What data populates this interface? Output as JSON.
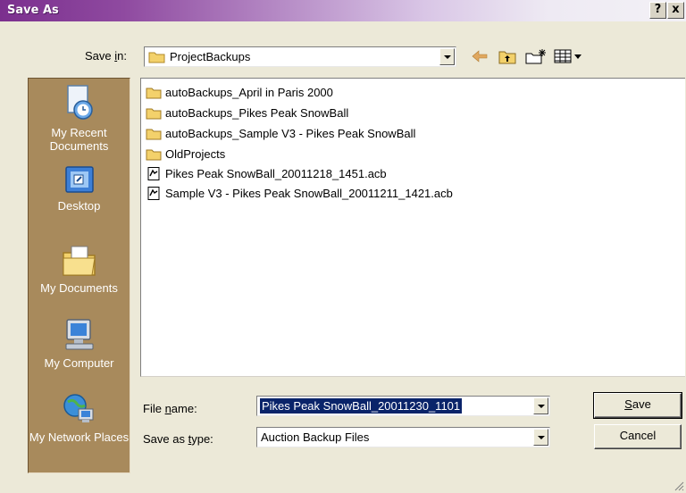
{
  "window": {
    "title": "Save As",
    "help_label": "?",
    "close_label": "x"
  },
  "save_in": {
    "label_pre": "Save ",
    "label_accel": "i",
    "label_post": "n:",
    "value": "ProjectBackups"
  },
  "places": [
    {
      "label": "My Recent Documents",
      "icon": "recent-documents-icon"
    },
    {
      "label": "Desktop",
      "icon": "desktop-icon"
    },
    {
      "label": "My Documents",
      "icon": "my-documents-icon"
    },
    {
      "label": "My Computer",
      "icon": "my-computer-icon"
    },
    {
      "label": "My Network Places",
      "icon": "network-places-icon"
    }
  ],
  "files": [
    {
      "name": "autoBackups_April in Paris 2000",
      "type": "folder"
    },
    {
      "name": "autoBackups_Pikes Peak SnowBall",
      "type": "folder"
    },
    {
      "name": "autoBackups_Sample V3 - Pikes Peak SnowBall",
      "type": "folder"
    },
    {
      "name": "OldProjects",
      "type": "folder"
    },
    {
      "name": "Pikes Peak SnowBall_20011218_1451.acb",
      "type": "file"
    },
    {
      "name": "Sample V3 - Pikes Peak SnowBall_20011211_1421.acb",
      "type": "file"
    }
  ],
  "file_name": {
    "label_pre": "File ",
    "label_accel": "n",
    "label_post": "ame:",
    "value": "Pikes Peak SnowBall_20011230_1101"
  },
  "file_type": {
    "label_pre": "Save as ",
    "label_accel": "t",
    "label_post": "ype:",
    "value": "Auction Backup Files"
  },
  "buttons": {
    "save_accel": "S",
    "save_rest": "ave",
    "cancel": "Cancel"
  },
  "colors": {
    "places_bar": "#a88a5c",
    "selection": "#0a246a",
    "folder": "#f3d16b"
  }
}
